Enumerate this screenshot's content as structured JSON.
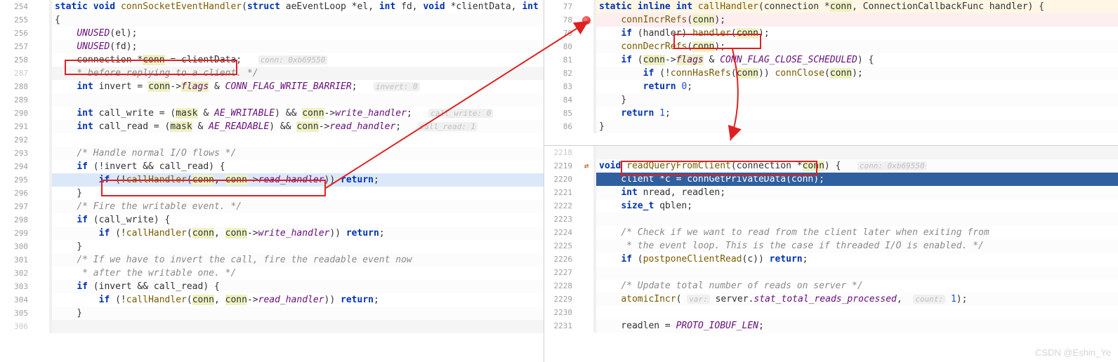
{
  "watermark": "CSDN @Eshin_Ye",
  "left": {
    "lines": [
      {
        "ln": "254",
        "k": "plain",
        "txt": "static void connSocketEventHandler(struct aeEventLoop *el, int fd, void *clientData, int"
      },
      {
        "ln": "255",
        "k": "plain",
        "txt": "{"
      },
      {
        "ln": "256",
        "k": "plain",
        "txt": "    UNUSED(el);"
      },
      {
        "ln": "257",
        "k": "plain",
        "txt": "    UNUSED(fd);"
      },
      {
        "ln": "258",
        "k": "plain",
        "txt": "    connection *conn = clientData;",
        "hint": "conn: 0xb69550"
      },
      {
        "ln": "287",
        "k": "dim",
        "txt": "    * before replying to a client. */"
      },
      {
        "ln": "288",
        "k": "plain",
        "txt": "    int invert = conn->flags & CONN_FLAG_WRITE_BARRIER;",
        "hint": "invert: 0"
      },
      {
        "ln": "289",
        "k": "plain",
        "txt": ""
      },
      {
        "ln": "290",
        "k": "plain",
        "txt": "    int call_write = (mask & AE_WRITABLE) && conn->write_handler;",
        "hint": "call_write: 0"
      },
      {
        "ln": "291",
        "k": "plain",
        "txt": "    int call_read = (mask & AE_READABLE) && conn->read_handler;",
        "hint": "call_read: 1"
      },
      {
        "ln": "292",
        "k": "plain",
        "txt": ""
      },
      {
        "ln": "293",
        "k": "plain",
        "txt": "    /* Handle normal I/O flows */"
      },
      {
        "ln": "294",
        "k": "plain",
        "txt": "    if (!invert && call_read) {"
      },
      {
        "ln": "295",
        "k": "hl",
        "txt": "        if (!callHandler(conn, conn->read_handler)) return;"
      },
      {
        "ln": "296",
        "k": "plain",
        "txt": "    }"
      },
      {
        "ln": "297",
        "k": "plain",
        "txt": "    /* Fire the writable event. */"
      },
      {
        "ln": "298",
        "k": "plain",
        "txt": "    if (call_write) {"
      },
      {
        "ln": "299",
        "k": "plain",
        "txt": "        if (!callHandler(conn, conn->write_handler)) return;"
      },
      {
        "ln": "300",
        "k": "plain",
        "txt": "    }"
      },
      {
        "ln": "301",
        "k": "plain",
        "txt": "    /* If we have to invert the call, fire the readable event now"
      },
      {
        "ln": "302",
        "k": "plain",
        "txt": "     * after the writable one. */"
      },
      {
        "ln": "303",
        "k": "plain",
        "txt": "    if (invert && call_read) {"
      },
      {
        "ln": "304",
        "k": "plain",
        "txt": "        if (!callHandler(conn, conn->read_handler)) return;"
      },
      {
        "ln": "305",
        "k": "plain",
        "txt": "    }"
      },
      {
        "ln": "306",
        "k": "dim",
        "txt": ""
      }
    ]
  },
  "right_top": {
    "lines": [
      {
        "ln": "77",
        "k": "warn",
        "txt": "static inline int callHandler(connection *conn, ConnectionCallbackFunc handler) {"
      },
      {
        "ln": "78",
        "k": "pink",
        "txt": "    connIncrRefs(conn);",
        "mark": "bp"
      },
      {
        "ln": "79",
        "k": "plain",
        "txt": "    if (handler) handler(conn);"
      },
      {
        "ln": "80",
        "k": "plain",
        "txt": "    connDecrRefs(conn);"
      },
      {
        "ln": "81",
        "k": "plain",
        "txt": "    if (conn->flags & CONN_FLAG_CLOSE_SCHEDULED) {"
      },
      {
        "ln": "82",
        "k": "plain",
        "txt": "        if (!connHasRefs(conn)) connClose(conn);"
      },
      {
        "ln": "83",
        "k": "plain",
        "txt": "        return 0;"
      },
      {
        "ln": "84",
        "k": "plain",
        "txt": "    }"
      },
      {
        "ln": "85",
        "k": "plain",
        "txt": "    return 1;"
      },
      {
        "ln": "86",
        "k": "plain",
        "txt": "}"
      }
    ]
  },
  "right_bottom": {
    "lines": [
      {
        "ln": "2218",
        "k": "dim",
        "txt": ""
      },
      {
        "ln": "2219",
        "k": "plain",
        "txt": "void readQueryFromClient(connection *conn) {",
        "hint": "conn: 0xb69550",
        "mark": "diff"
      },
      {
        "ln": "2220",
        "k": "sel",
        "txt": "    client *c = connGetPrivateData(conn);"
      },
      {
        "ln": "2221",
        "k": "plain",
        "txt": "    int nread, readlen;"
      },
      {
        "ln": "2222",
        "k": "plain",
        "txt": "    size_t qblen;"
      },
      {
        "ln": "2223",
        "k": "plain",
        "txt": ""
      },
      {
        "ln": "2224",
        "k": "plain",
        "txt": "    /* Check if we want to read from the client later when exiting from"
      },
      {
        "ln": "2225",
        "k": "plain",
        "txt": "     * the event loop. This is the case if threaded I/O is enabled. */"
      },
      {
        "ln": "2226",
        "k": "plain",
        "txt": "    if (postponeClientRead(c)) return;"
      },
      {
        "ln": "2227",
        "k": "plain",
        "txt": ""
      },
      {
        "ln": "2228",
        "k": "plain",
        "txt": "    /* Update total number of reads on server */"
      },
      {
        "ln": "2229",
        "k": "plain",
        "txt": "    atomicIncr( var: server.stat_total_reads_processed,  count: 1);"
      },
      {
        "ln": "2230",
        "k": "plain",
        "txt": ""
      },
      {
        "ln": "2231",
        "k": "plain",
        "txt": "    readlen = PROTO_IOBUF_LEN;"
      }
    ]
  },
  "highlight_terms": [
    "conn",
    "mask",
    "flags"
  ],
  "red_boxes": {
    "box1_label": "connection *conn = clientData;",
    "box2_label": "(!callHandler(conn, conn->read_handler))",
    "box3_label": "handler(conn);",
    "box4_label": "readQueryFromClient(connection *conn)"
  }
}
